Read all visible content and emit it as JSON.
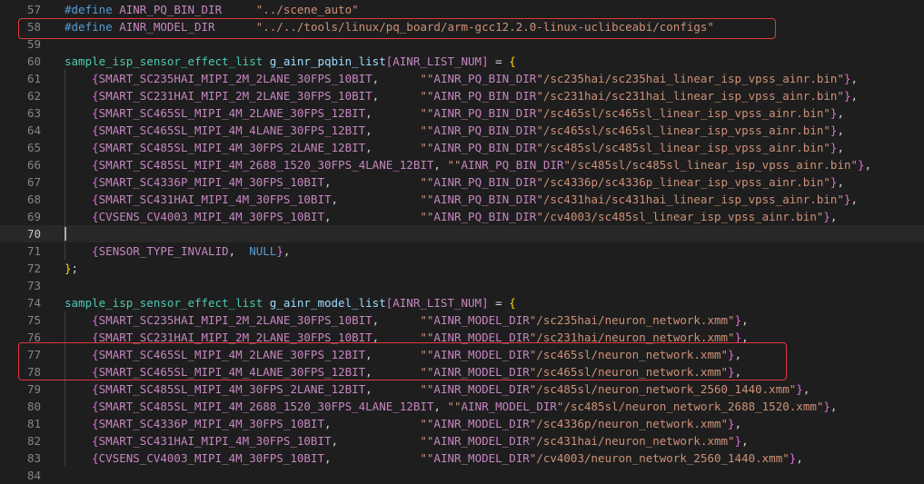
{
  "editor": {
    "lines": [
      {
        "num": "57",
        "code": "#define AINR_PQ_BIN_DIR     \"../scene_auto\""
      },
      {
        "num": "58",
        "code": "#define AINR_MODEL_DIR      \"../../tools/linux/pq_board/arm-gcc12.2.0-linux-uclibceabi/configs\""
      },
      {
        "num": "59",
        "code": ""
      },
      {
        "num": "60",
        "code": "sample_isp_sensor_effect_list g_ainr_pqbin_list[AINR_LIST_NUM] = {"
      },
      {
        "num": "61",
        "code": "    {SMART_SC235HAI_MIPI_2M_2LANE_30FPS_10BIT,      \"\"AINR_PQ_BIN_DIR\"/sc235hai/sc235hai_linear_isp_vpss_ainr.bin\"},"
      },
      {
        "num": "62",
        "code": "    {SMART_SC231HAI_MIPI_2M_2LANE_30FPS_10BIT,      \"\"AINR_PQ_BIN_DIR\"/sc231hai/sc231hai_linear_isp_vpss_ainr.bin\"},"
      },
      {
        "num": "63",
        "code": "    {SMART_SC465SL_MIPI_4M_2LANE_30FPS_12BIT,       \"\"AINR_PQ_BIN_DIR\"/sc465sl/sc465sl_linear_isp_vpss_ainr.bin\"},"
      },
      {
        "num": "64",
        "code": "    {SMART_SC465SL_MIPI_4M_4LANE_30FPS_12BIT,       \"\"AINR_PQ_BIN_DIR\"/sc465sl/sc465sl_linear_isp_vpss_ainr.bin\"},"
      },
      {
        "num": "65",
        "code": "    {SMART_SC485SL_MIPI_4M_30FPS_2LANE_12BIT,       \"\"AINR_PQ_BIN_DIR\"/sc485sl/sc485sl_linear_isp_vpss_ainr.bin\"},"
      },
      {
        "num": "66",
        "code": "    {SMART_SC485SL_MIPI_4M_2688_1520_30FPS_4LANE_12BIT, \"\"AINR_PQ_BIN_DIR\"/sc485sl/sc485sl_linear_isp_vpss_ainr.bin\"},"
      },
      {
        "num": "67",
        "code": "    {SMART_SC4336P_MIPI_4M_30FPS_10BIT,             \"\"AINR_PQ_BIN_DIR\"/sc4336p/sc4336p_linear_isp_vpss_ainr.bin\"},"
      },
      {
        "num": "68",
        "code": "    {SMART_SC431HAI_MIPI_4M_30FPS_10BIT,            \"\"AINR_PQ_BIN_DIR\"/sc431hai/sc431hai_linear_isp_vpss_ainr.bin\"},"
      },
      {
        "num": "69",
        "code": "    {CVSENS_CV4003_MIPI_4M_30FPS_10BIT,             \"\"AINR_PQ_BIN_DIR\"/cv4003/sc485sl_linear_isp_vpss_ainr.bin\"},"
      },
      {
        "num": "70",
        "code": ""
      },
      {
        "num": "71",
        "code": "    {SENSOR_TYPE_INVALID,  NULL},"
      },
      {
        "num": "72",
        "code": "};"
      },
      {
        "num": "73",
        "code": ""
      },
      {
        "num": "74",
        "code": "sample_isp_sensor_effect_list g_ainr_model_list[AINR_LIST_NUM] = {"
      },
      {
        "num": "75",
        "code": "    {SMART_SC235HAI_MIPI_2M_2LANE_30FPS_10BIT,      \"\"AINR_MODEL_DIR\"/sc235hai/neuron_network.xmm\"},"
      },
      {
        "num": "76",
        "code": "    {SMART_SC231HAI_MIPI_2M_2LANE_30FPS_10BIT,      \"\"AINR_MODEL_DIR\"/sc231hai/neuron_network.xmm\"},"
      },
      {
        "num": "77",
        "code": "    {SMART_SC465SL_MIPI_4M_2LANE_30FPS_12BIT,       \"\"AINR_MODEL_DIR\"/sc465sl/neuron_network.xmm\"},"
      },
      {
        "num": "78",
        "code": "    {SMART_SC465SL_MIPI_4M_4LANE_30FPS_12BIT,       \"\"AINR_MODEL_DIR\"/sc465sl/neuron_network.xmm\"},"
      },
      {
        "num": "79",
        "code": "    {SMART_SC485SL_MIPI_4M_30FPS_2LANE_12BIT,       \"\"AINR_MODEL_DIR\"/sc485sl/neuron_network_2560_1440.xmm\"},"
      },
      {
        "num": "80",
        "code": "    {SMART_SC485SL_MIPI_4M_2688_1520_30FPS_4LANE_12BIT, \"\"AINR_MODEL_DIR\"/sc485sl/neuron_network_2688_1520.xmm\"},"
      },
      {
        "num": "81",
        "code": "    {SMART_SC4336P_MIPI_4M_30FPS_10BIT,             \"\"AINR_MODEL_DIR\"/sc4336p/neuron_network.xmm\"},"
      },
      {
        "num": "82",
        "code": "    {SMART_SC431HAI_MIPI_4M_30FPS_10BIT,            \"\"AINR_MODEL_DIR\"/sc431hai/neuron_network.xmm\"},"
      },
      {
        "num": "83",
        "code": "    {CVSENS_CV4003_MIPI_4M_30FPS_10BIT,             \"\"AINR_MODEL_DIR\"/cv4003/neuron_network_2560_1440.xmm\"},"
      },
      {
        "num": "84",
        "code": ""
      }
    ],
    "current_line": "70",
    "highlighted_lines": [
      [
        "58"
      ],
      [
        "77",
        "78"
      ]
    ]
  },
  "theme": {
    "background": "#1e1e1e",
    "current_line_background": "#282828",
    "highlight_border": "#e0393e"
  }
}
